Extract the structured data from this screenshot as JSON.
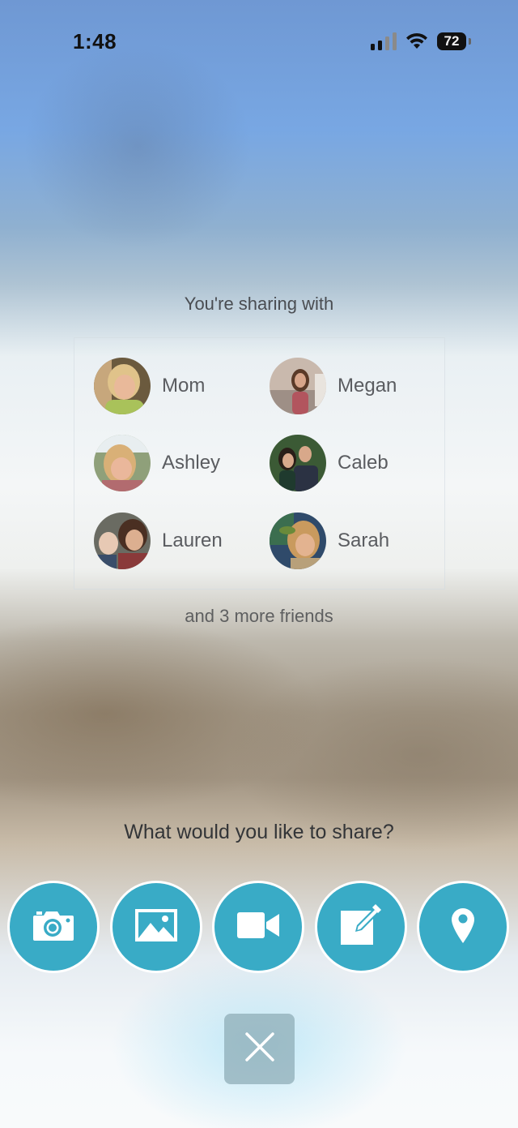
{
  "status_bar": {
    "time": "1:48",
    "battery_level": "72",
    "icons": [
      "signal-icon",
      "wifi-icon",
      "battery-icon"
    ]
  },
  "sharing": {
    "title": "You're sharing with",
    "friends": [
      {
        "name": "Mom"
      },
      {
        "name": "Megan"
      },
      {
        "name": "Ashley"
      },
      {
        "name": "Caleb"
      },
      {
        "name": "Lauren"
      },
      {
        "name": "Sarah"
      }
    ],
    "more_text": "and 3 more friends"
  },
  "share": {
    "question": "What would you like to share?",
    "options": [
      {
        "icon": "camera-icon"
      },
      {
        "icon": "photo-icon"
      },
      {
        "icon": "video-icon"
      },
      {
        "icon": "note-icon"
      },
      {
        "icon": "location-pin-icon"
      }
    ],
    "close_icon": "close-icon"
  },
  "colors": {
    "accent": "#39abc6",
    "button_border": "#ffffff",
    "close_button": "#8caab4"
  }
}
